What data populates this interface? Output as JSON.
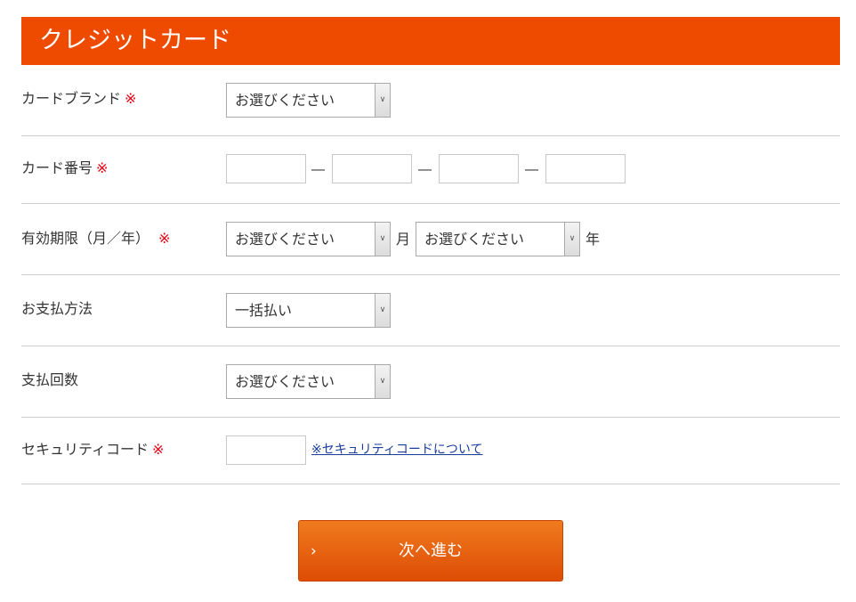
{
  "header": {
    "title": "クレジットカード"
  },
  "required_mark": "※",
  "brand": {
    "label": "カードブランド",
    "value": "お選びください"
  },
  "card_number": {
    "label": "カード番号",
    "separator": "―"
  },
  "expiry": {
    "label": "有効期限（月／年）",
    "month_value": "お選びください",
    "month_unit": "月",
    "year_value": "お選びください",
    "year_unit": "年"
  },
  "payment_method": {
    "label": "お支払方法",
    "value": "一括払い"
  },
  "installments": {
    "label": "支払回数",
    "value": "お選びください"
  },
  "security": {
    "label": "セキュリティコード",
    "link_text": "※セキュリティコードについて"
  },
  "submit": {
    "label": "次へ進む",
    "chevron": "›"
  },
  "colors": {
    "accent": "#ee4b00",
    "required": "#e60012",
    "link": "#1a3d9c"
  }
}
